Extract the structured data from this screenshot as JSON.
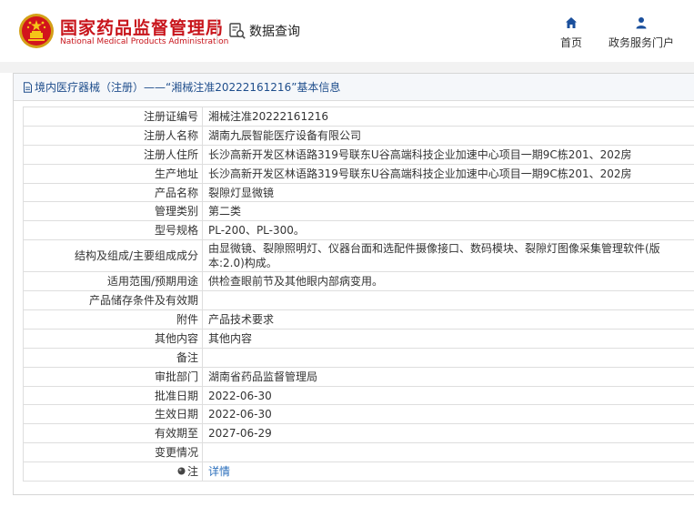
{
  "header": {
    "brand_cn": "国家药品监督管理局",
    "brand_en": "National Medical Products Administration",
    "query_label": "数据查询",
    "nav_home": "首页",
    "nav_service": "政务服务门户"
  },
  "breadcrumb": {
    "text": "境内医疗器械（注册）——“湘械注准20222161216”基本信息"
  },
  "rows": [
    {
      "label": "注册证编号",
      "value": "湘械注准20222161216"
    },
    {
      "label": "注册人名称",
      "value": "湖南九辰智能医疗设备有限公司"
    },
    {
      "label": "注册人住所",
      "value": "长沙高新开发区林语路319号联东U谷高端科技企业加速中心项目一期9C栋201、202房"
    },
    {
      "label": "生产地址",
      "value": "长沙高新开发区林语路319号联东U谷高端科技企业加速中心项目一期9C栋201、202房"
    },
    {
      "label": "产品名称",
      "value": "裂隙灯显微镜"
    },
    {
      "label": "管理类别",
      "value": "第二类"
    },
    {
      "label": "型号规格",
      "value": "PL-200、PL-300。"
    },
    {
      "label": "结构及组成/主要组成成分",
      "value": "由显微镜、裂隙照明灯、仪器台面和选配件摄像接口、数码模块、裂隙灯图像采集管理软件(版本:2.0)构成。"
    },
    {
      "label": "适用范围/预期用途",
      "value": "供检查眼前节及其他眼内部病变用。"
    },
    {
      "label": "产品储存条件及有效期",
      "value": ""
    },
    {
      "label": "附件",
      "value": "产品技术要求"
    },
    {
      "label": "其他内容",
      "value": "其他内容"
    },
    {
      "label": "备注",
      "value": ""
    },
    {
      "label": "审批部门",
      "value": "湖南省药品监督管理局"
    },
    {
      "label": "批准日期",
      "value": "2022-06-30"
    },
    {
      "label": "生效日期",
      "value": "2022-06-30"
    },
    {
      "label": "有效期至",
      "value": "2027-06-29"
    },
    {
      "label": "变更情况",
      "value": ""
    },
    {
      "label": "注",
      "value": "详情"
    }
  ],
  "colors": {
    "brand_red": "#c8141b",
    "link_blue": "#2a6ebb",
    "title_blue": "#1f4e8c",
    "nav_blue": "#1a4f9c"
  }
}
